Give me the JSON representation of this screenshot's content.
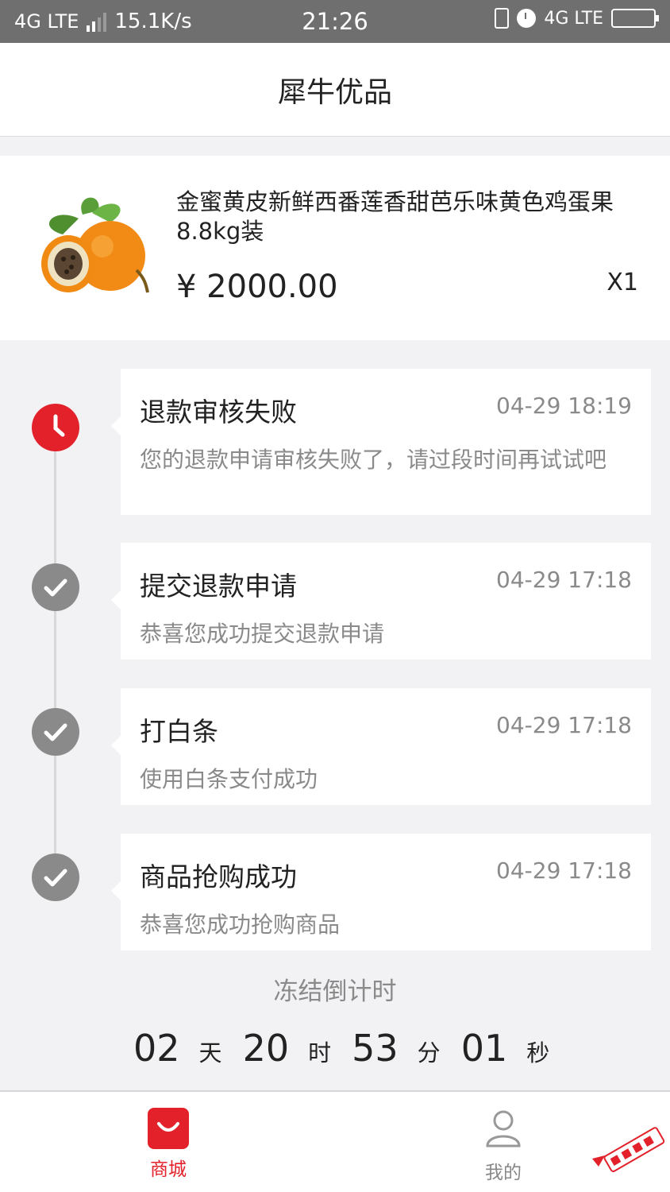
{
  "status_bar": {
    "network_left": "4G LTE",
    "speed": "15.1K/s",
    "time": "21:26",
    "network_right": "4G LTE"
  },
  "header": {
    "title": "犀牛优品"
  },
  "product": {
    "name": "金蜜黄皮新鲜西番莲香甜芭乐味黄色鸡蛋果8.8kg装",
    "price": "¥ 2000.00",
    "quantity": "X1"
  },
  "timeline": [
    {
      "title": "退款审核失败",
      "time": "04-29 18:19",
      "desc": "您的退款申请审核失败了，请过段时间再试试吧",
      "icon": "clock-icon",
      "status": "fail"
    },
    {
      "title": "提交退款申请",
      "time": "04-29 17:18",
      "desc": "恭喜您成功提交退款申请",
      "icon": "check-icon",
      "status": "done"
    },
    {
      "title": "打白条",
      "time": "04-29 17:18",
      "desc": "使用白条支付成功",
      "icon": "check-icon",
      "status": "done"
    },
    {
      "title": "商品抢购成功",
      "time": "04-29 17:18",
      "desc": "恭喜您成功抢购商品",
      "icon": "check-icon",
      "status": "done"
    }
  ],
  "countdown": {
    "label": "冻结倒计时",
    "days": "02",
    "days_unit": "天",
    "hours": "20",
    "hours_unit": "时",
    "minutes": "53",
    "minutes_unit": "分",
    "seconds": "01",
    "seconds_unit": "秒"
  },
  "tabbar": {
    "shop_label": "商城",
    "me_label": "我的"
  },
  "colors": {
    "accent": "#e3212b",
    "done_gray": "#8a8a8a",
    "status_bar": "#6f6f6f",
    "page_bg": "#f2f2f4"
  }
}
